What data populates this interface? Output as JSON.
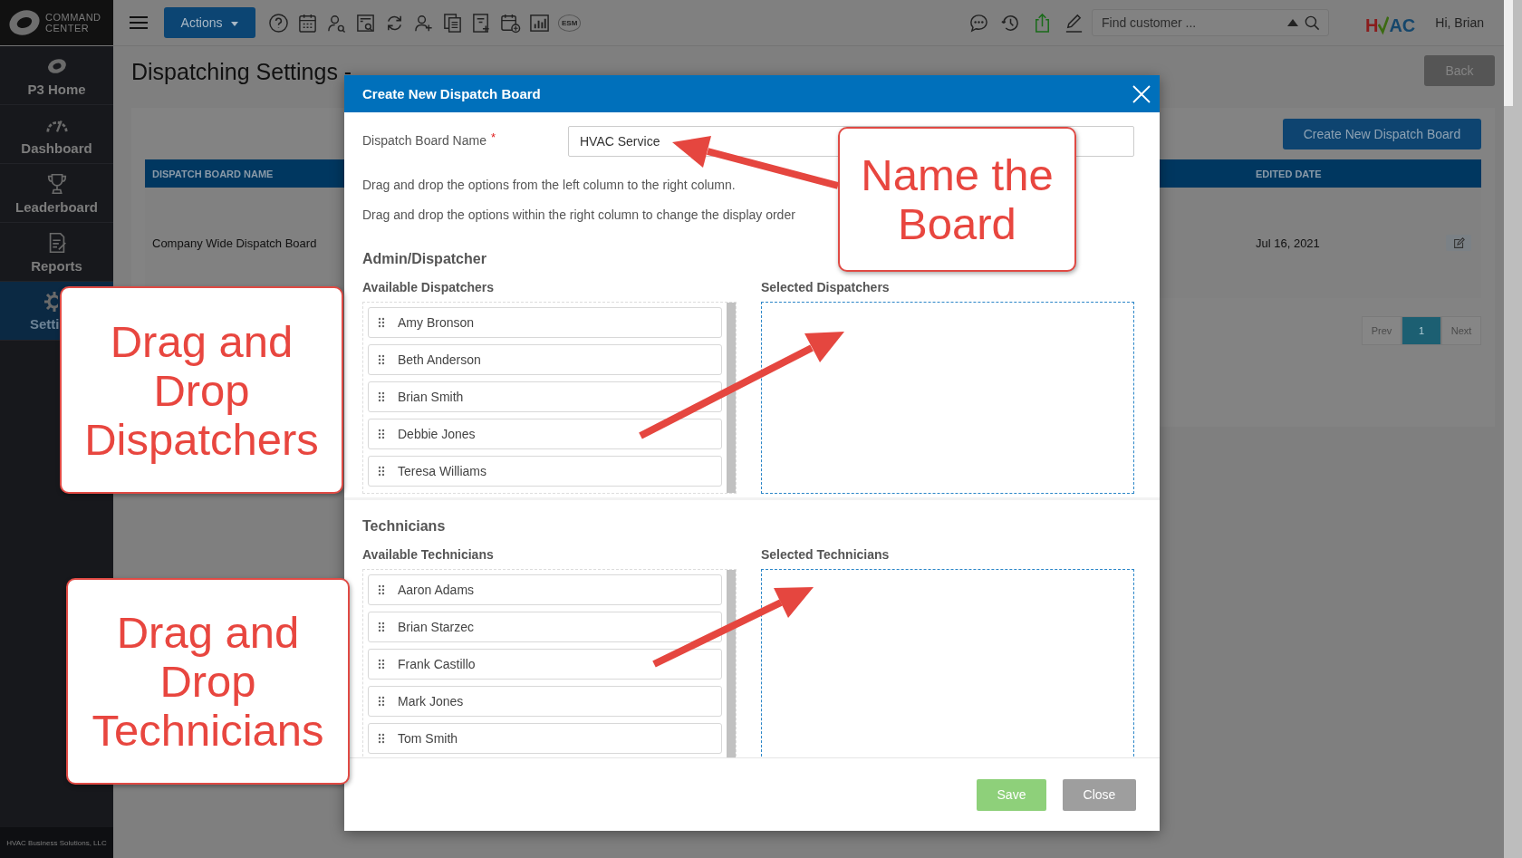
{
  "top_bar": {
    "brand_lines": [
      "COMMAND",
      "CENTER"
    ],
    "actions_button": "Actions",
    "esm_badge": "ESM",
    "search": {
      "placeholder": "Find customer ..."
    },
    "company_logo": {
      "left": "H",
      "right": "AC"
    },
    "greeting": "Hi, Brian"
  },
  "sidebar": {
    "items": [
      {
        "label": "P3 Home",
        "kind": "home",
        "selected": false
      },
      {
        "label": "Dashboard",
        "kind": "gauge",
        "selected": false
      },
      {
        "label": "Leaderboard",
        "kind": "trophy",
        "selected": false
      },
      {
        "label": "Reports",
        "kind": "report",
        "selected": false
      },
      {
        "label": "Setti",
        "kind": "gear",
        "selected": true
      }
    ],
    "footer": "HVAC Business Solutions, LLC"
  },
  "page": {
    "title": "Dispatching Settings -",
    "back_button": "Back",
    "create_button": "Create New Dispatch Board",
    "table": {
      "columns": [
        "DISPATCH BOARD NAME",
        "EDITED DATE"
      ],
      "rows": [
        {
          "name": "Company Wide Dispatch Board",
          "edited_date": "Jul 16, 2021"
        }
      ]
    },
    "pagination": {
      "prev": "Prev",
      "pages": [
        {
          "label": "1",
          "selected": true
        }
      ],
      "next": "Next"
    }
  },
  "modal": {
    "title": "Create New Dispatch Board",
    "name_field": {
      "label": "Dispatch Board Name",
      "required_mark": "*",
      "value": "HVAC Service"
    },
    "instructions": [
      "Drag and drop the options from the left column to the right column.",
      "Drag and drop the options within the right column to change the display order"
    ],
    "sections": [
      {
        "title": "Admin/Dispatcher",
        "available_label": "Available Dispatchers",
        "selected_label": "Selected Dispatchers",
        "available": [
          "Amy Bronson",
          "Beth Anderson",
          "Brian Smith",
          "Debbie Jones",
          "Teresa Williams"
        ]
      },
      {
        "title": "Technicians",
        "available_label": "Available Technicians",
        "selected_label": "Selected Technicians",
        "available": [
          "Aaron Adams",
          "Brian Starzec",
          "Frank Castillo",
          "Mark Jones",
          "Tom Smith"
        ]
      }
    ],
    "buttons": [
      {
        "label": "Save",
        "kind": "primary"
      },
      {
        "label": "Close",
        "kind": "secondary"
      }
    ]
  },
  "annotations": [
    {
      "text": "Name the Board",
      "kind": "name"
    },
    {
      "text": "Drag and Drop Dispatchers",
      "kind": "dispatchers"
    },
    {
      "text": "Drag and Drop Technicians",
      "kind": "technicians"
    }
  ]
}
